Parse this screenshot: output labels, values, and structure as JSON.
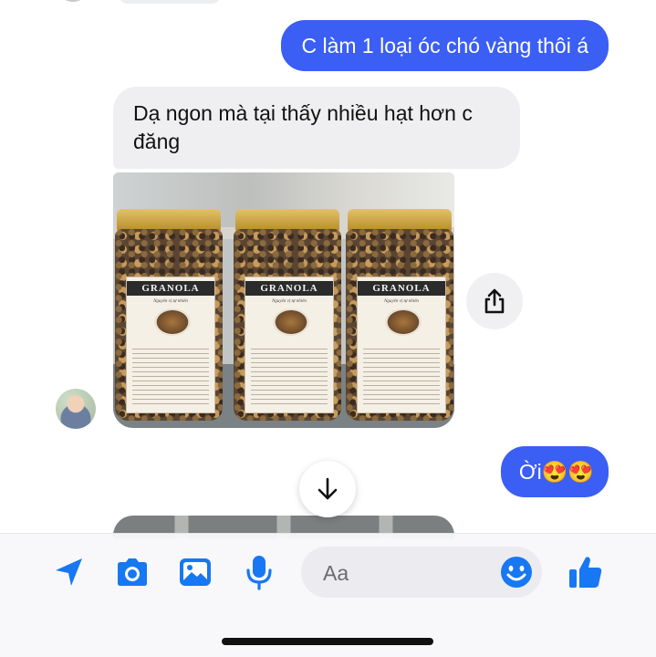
{
  "messages": {
    "out_1": "C làm 1 loại óc chó vàng thôi á",
    "in_1": "Dạ ngon mà tại thấy nhiều hạt hơn c đăng",
    "out_2": "Ời😍😍"
  },
  "photo": {
    "jar_label": "GRANOLA",
    "jar_subtitle": "Nguyên vị tự nhiên"
  },
  "composer": {
    "placeholder": "Aa"
  },
  "colors": {
    "accent": "#3b5ef4",
    "icon": "#1877f2",
    "incoming_bubble": "#efeff1"
  },
  "icons": [
    "location-arrow-icon",
    "camera-icon",
    "gallery-icon",
    "microphone-icon",
    "emoji-icon",
    "thumbs-up-icon",
    "share-icon",
    "arrow-down-icon"
  ]
}
